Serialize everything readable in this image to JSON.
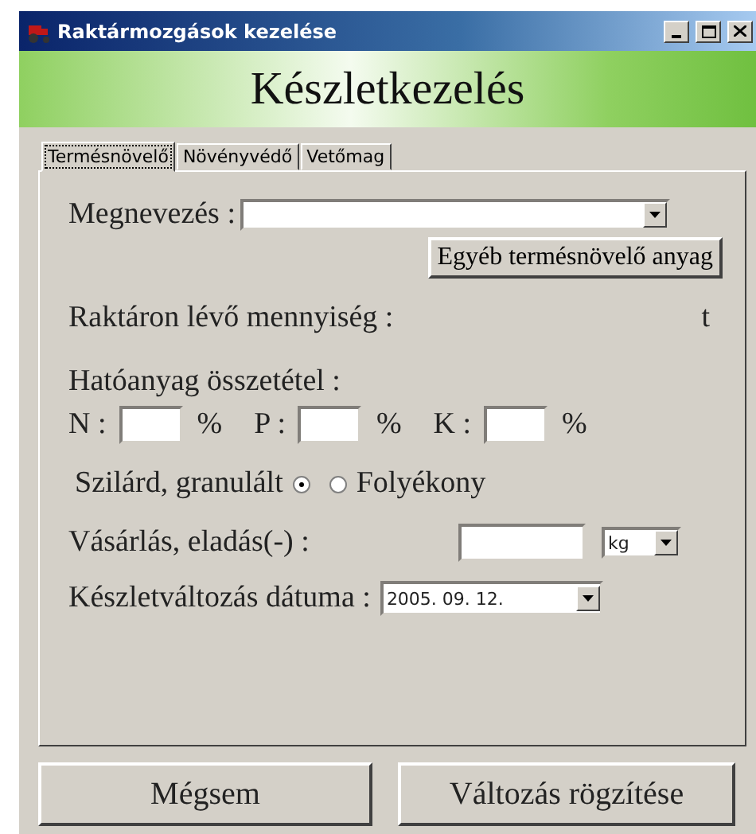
{
  "window": {
    "title": "Raktármozgások kezelése"
  },
  "header": "Készletkezelés",
  "tabs": [
    {
      "label": "Termésnövelő",
      "selected": true
    },
    {
      "label": "Növényvédő",
      "selected": false
    },
    {
      "label": "Vetőmag",
      "selected": false
    }
  ],
  "name_field": {
    "label": "Megnevezés :"
  },
  "other_button": "Egyéb termésnövelő anyag",
  "stock": {
    "label": "Raktáron lévő mennyiség :",
    "unit": "t"
  },
  "composition": {
    "label": "Hatóanyag összetétel :",
    "nutrients": [
      {
        "label": "N :",
        "unit": "%"
      },
      {
        "label": "P :",
        "unit": "%"
      },
      {
        "label": "K :",
        "unit": "%"
      }
    ]
  },
  "form_options": [
    {
      "label": "Szilárd, granulált",
      "selected": true,
      "kind": "leading"
    },
    {
      "label": "Folyékony",
      "selected": false,
      "kind": "trailing"
    }
  ],
  "quantity": {
    "label": "Vásárlás, eladás(-) :",
    "unit": "kg"
  },
  "date": {
    "label": "Készletváltozás dátuma :",
    "value": "2005. 09. 12."
  },
  "buttons": [
    "Mégsem",
    "Változás rögzítése"
  ]
}
